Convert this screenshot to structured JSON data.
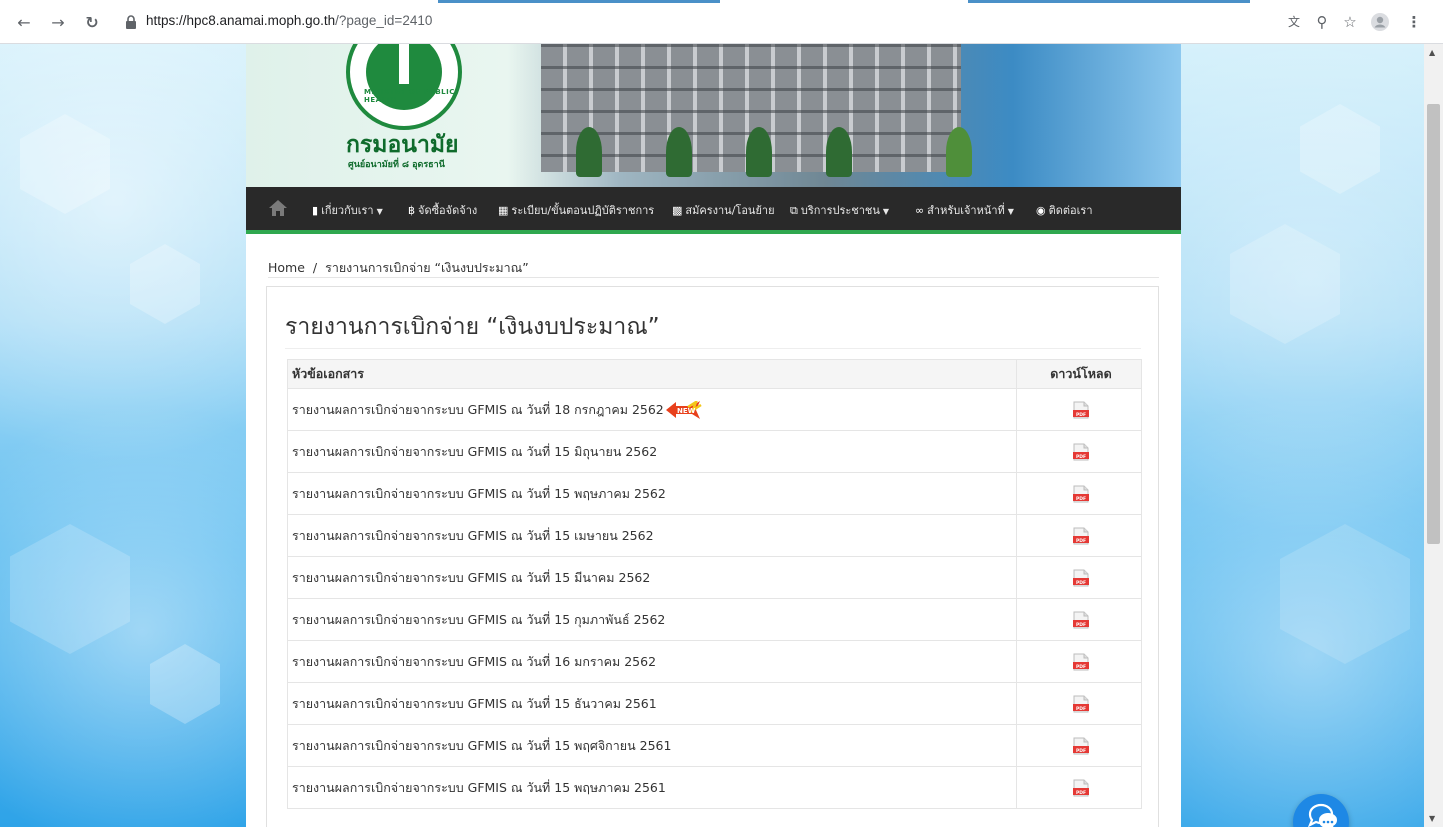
{
  "browser": {
    "url_main": "https://hpc8.anamai.moph.go.th",
    "url_path": "/?page_id=2410"
  },
  "site": {
    "brand_name": "กรมอนามัย",
    "brand_sub": "ศูนย์อนามัยที่ ๘ อุดรธานี",
    "logo_ring_text": "MINISTRY OF PUBLIC HEALTH"
  },
  "nav": {
    "items": [
      {
        "label": "เกี่ยวกับเรา",
        "icon": "bookmark-icon",
        "dropdown": true
      },
      {
        "label": "จัดซื้อจัดจ้าง",
        "icon": "baht-icon",
        "dropdown": false
      },
      {
        "label": "ระเบียบ/ขั้นตอนปฏิบัติราชการ",
        "icon": "book-icon",
        "dropdown": false
      },
      {
        "label": "สมัครงาน/โอนย้าย",
        "icon": "briefcase-icon",
        "dropdown": false
      },
      {
        "label": "บริการประชาชน",
        "icon": "external-link-icon",
        "dropdown": true
      },
      {
        "label": "สำหรับเจ้าหน้าที่",
        "icon": "link-icon",
        "dropdown": true
      },
      {
        "label": "ติดต่อเรา",
        "icon": "map-marker-icon",
        "dropdown": false
      }
    ]
  },
  "breadcrumb": {
    "home": "Home",
    "separator": "/",
    "current": "รายงานการเบิกจ่าย “เงินงบประมาณ”"
  },
  "main": {
    "title": "รายงานการเบิกจ่าย “เงินงบประมาณ”",
    "table": {
      "headers": [
        "หัวข้อเอกสาร",
        "ดาวน์โหลด"
      ],
      "rows": [
        {
          "title": "รายงานผลการเบิกจ่ายจากระบบ GFMIS ณ วันที่ 18 กรกฎาคม 2562",
          "is_new": true
        },
        {
          "title": "รายงานผลการเบิกจ่ายจากระบบ GFMIS ณ วันที่ 15 มิถุนายน 2562",
          "is_new": false
        },
        {
          "title": "รายงานผลการเบิกจ่ายจากระบบ GFMIS ณ วันที่ 15 พฤษภาคม 2562",
          "is_new": false
        },
        {
          "title": "รายงานผลการเบิกจ่ายจากระบบ GFMIS ณ วันที่ 15 เมษายน 2562",
          "is_new": false
        },
        {
          "title": "รายงานผลการเบิกจ่ายจากระบบ GFMIS ณ วันที่ 15 มีนาคม 2562",
          "is_new": false
        },
        {
          "title": "รายงานผลการเบิกจ่ายจากระบบ GFMIS ณ วันที่ 15 กุมภาพันธ์ 2562",
          "is_new": false
        },
        {
          "title": "รายงานผลการเบิกจ่ายจากระบบ GFMIS ณ วันที่ 16 มกราคม 2562",
          "is_new": false
        },
        {
          "title": "รายงานผลการเบิกจ่ายจากระบบ GFMIS ณ วันที่ 15 ธันวาคม 2561",
          "is_new": false
        },
        {
          "title": "รายงานผลการเบิกจ่ายจากระบบ GFMIS ณ วันที่ 15 พฤศจิกายน 2561",
          "is_new": false
        },
        {
          "title": "รายงานผลการเบิกจ่ายจากระบบ GFMIS ณ วันที่ 15 พฤษภาคม 2561",
          "is_new": false
        }
      ],
      "download_icon": "pdf-icon",
      "new_badge_text": "NEW"
    }
  },
  "chat_widget": {
    "icon": "chat-icon"
  },
  "colors": {
    "nav_bg": "#292929",
    "nav_accent": "#2fa84f",
    "brand_green": "#0f6b2c",
    "chat_blue": "#1e88e5"
  }
}
